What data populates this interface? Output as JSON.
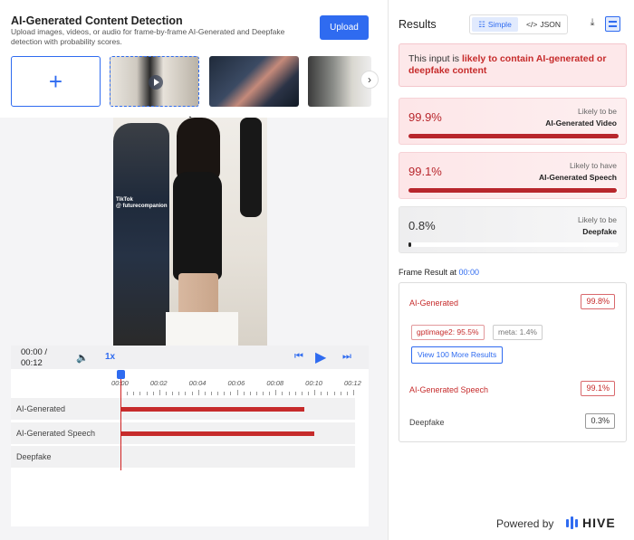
{
  "header": {
    "title": "AI-Generated Content Detection",
    "subtitle": "Upload images, videos, or audio for frame-by-frame AI-Generated and Deepfake detection with probability scores.",
    "upload_label": "Upload",
    "add_symbol": "+"
  },
  "video_overlay": {
    "watermark": "TikTok",
    "handle": "@ futurecompanion"
  },
  "player": {
    "time_current": "00:00 /",
    "time_total": "00:12",
    "speed": "1x",
    "ticks": [
      "00:00",
      "00:02",
      "00:04",
      "00:06",
      "00:08",
      "00:10",
      "00:12"
    ],
    "tracks": [
      {
        "label": "AI-Generated",
        "start": 0,
        "end": 0.907
      },
      {
        "label": "AI-Generated Speech",
        "start": 0,
        "end": 0.957
      },
      {
        "label": "Deepfake",
        "start": 0,
        "end": 0
      }
    ]
  },
  "results": {
    "title": "Results",
    "view_simple": "Simple",
    "view_json": "JSON",
    "banner_prefix": "This input is ",
    "banner_highlight": "likely to contain AI-generated or deepfake content",
    "cards": [
      {
        "pct": "99.9%",
        "line1": "Likely to be",
        "line2": "AI-Generated Video",
        "value": 0.999,
        "style": "red"
      },
      {
        "pct": "99.1%",
        "line1": "Likely to have",
        "line2": "AI-Generated Speech",
        "value": 0.991,
        "style": "red"
      },
      {
        "pct": "0.8%",
        "line1": "Likely to be",
        "line2": "Deepfake",
        "value": 0.008,
        "style": "grey"
      }
    ],
    "frame_label": "Frame Result at ",
    "frame_time": "00:00",
    "frame": {
      "ai_label": "AI-Generated",
      "ai_value": "99.8%",
      "chip1": "gptimage2: 95.5%",
      "chip2": "meta: 1.4%",
      "more_button": "View 100 More Results",
      "speech_label": "AI-Generated Speech",
      "speech_value": "99.1%",
      "deepfake_label": "Deepfake",
      "deepfake_value": "0.3%"
    },
    "powered_by": "Powered by",
    "brand": "HIVE"
  },
  "colors": {
    "accent": "#2f6bf0",
    "danger": "#c62b2b",
    "danger_bg": "#fde8ea"
  }
}
